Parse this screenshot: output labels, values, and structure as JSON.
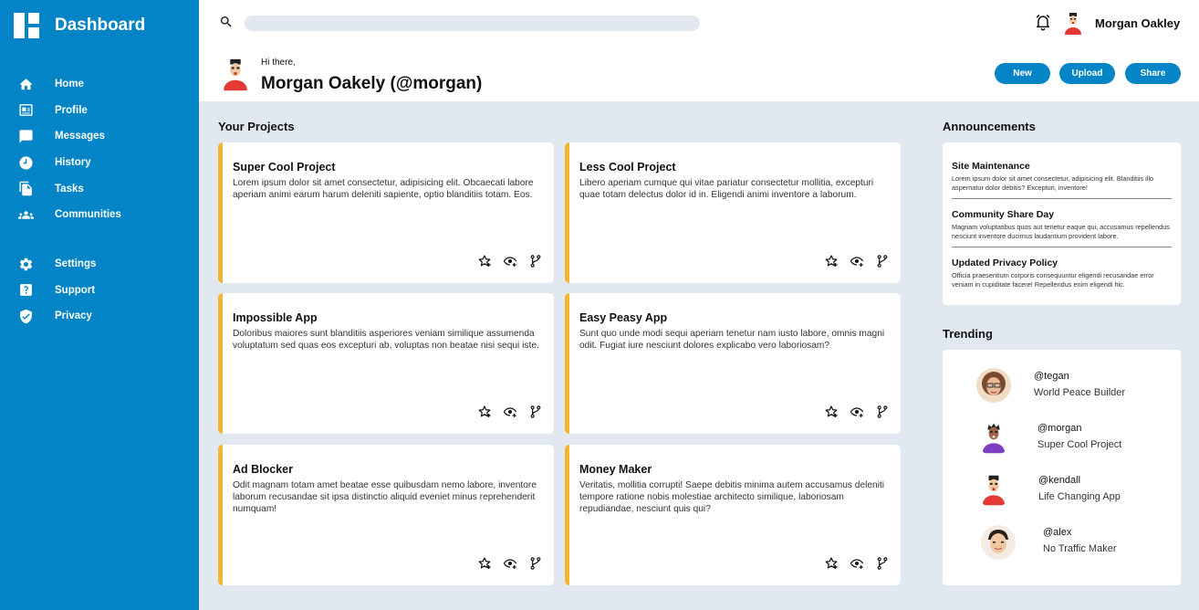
{
  "sidebar": {
    "title": "Dashboard",
    "main_items": [
      {
        "label": "Home",
        "icon": "home-icon"
      },
      {
        "label": "Profile",
        "icon": "profile-card-icon"
      },
      {
        "label": "Messages",
        "icon": "message-icon"
      },
      {
        "label": "History",
        "icon": "clock-icon"
      },
      {
        "label": "Tasks",
        "icon": "document-icon"
      },
      {
        "label": "Communities",
        "icon": "group-icon"
      }
    ],
    "secondary_items": [
      {
        "label": "Settings",
        "icon": "gear-icon"
      },
      {
        "label": "Support",
        "icon": "help-icon"
      },
      {
        "label": "Privacy",
        "icon": "shield-icon"
      }
    ]
  },
  "header": {
    "search_placeholder": "",
    "user_name": "Morgan Oakley",
    "greeting": "Hi there,",
    "greeting_name": "Morgan Oakely (@morgan)",
    "buttons": {
      "new": "New",
      "upload": "Upload",
      "share": "Share"
    }
  },
  "projects": {
    "title": "Your Projects",
    "items": [
      {
        "title": "Super Cool Project",
        "description": "Lorem ipsum dolor sit amet consectetur, adipisicing elit. Obcaecati labore aperiam animi earum harum deleniti sapiente, optio blanditiis totam. Eos."
      },
      {
        "title": "Less Cool Project",
        "description": "Libero aperiam cumque qui vitae pariatur consectetur mollitia, excepturi quae totam delectus dolor id in. Eligendi animi inventore a laborum."
      },
      {
        "title": "Impossible App",
        "description": "Doloribus maiores sunt blanditiis asperiores veniam similique assumenda voluptatum sed quas eos excepturi ab, voluptas non beatae nisi sequi iste."
      },
      {
        "title": "Easy Peasy App",
        "description": "Sunt quo unde modi sequi aperiam tenetur nam iusto labore, omnis magni odit. Fugiat iure nesciunt dolores explicabo vero laboriosam?"
      },
      {
        "title": "Ad Blocker",
        "description": "Odit magnam totam amet beatae esse quibusdam nemo labore, inventore laborum recusandae sit ipsa distinctio aliquid eveniet minus reprehenderit numquam!"
      },
      {
        "title": "Money Maker",
        "description": "Veritatis, mollitia corrupti! Saepe debitis minima autem accusamus deleniti tempore ratione nobis molestiae architecto similique, laboriosam repudiandae, nesciunt quis qui?"
      }
    ]
  },
  "announcements": {
    "title": "Announcements",
    "items": [
      {
        "title": "Site Maintenance",
        "body": "Lorem ipsum dolor sit amet consectetur, adipisicing elit. Blanditiis illo aspernatur dolor debitis? Excepturi, inventore!"
      },
      {
        "title": "Community Share Day",
        "body": "Magnam voluptatibus quos aut tenetur eaque qui, accusamus repellendus nesciunt inventore ducimus laudantium provident labore."
      },
      {
        "title": "Updated Privacy Policy",
        "body": "Officia praesentium corporis consequuntur eligendi recusandae error veniam in cupiditate facere! Repellendus enim eligendi hic."
      }
    ]
  },
  "trending": {
    "title": "Trending",
    "items": [
      {
        "handle": "@tegan",
        "subtitle": "World Peace Builder"
      },
      {
        "handle": "@morgan",
        "subtitle": "Super Cool Project"
      },
      {
        "handle": "@kendall",
        "subtitle": "Life Changing App"
      },
      {
        "handle": "@alex",
        "subtitle": "No Traffic Maker"
      }
    ]
  },
  "colors": {
    "primary": "#0284c7",
    "accent": "#f0b62f",
    "background": "#e2e8f0"
  }
}
